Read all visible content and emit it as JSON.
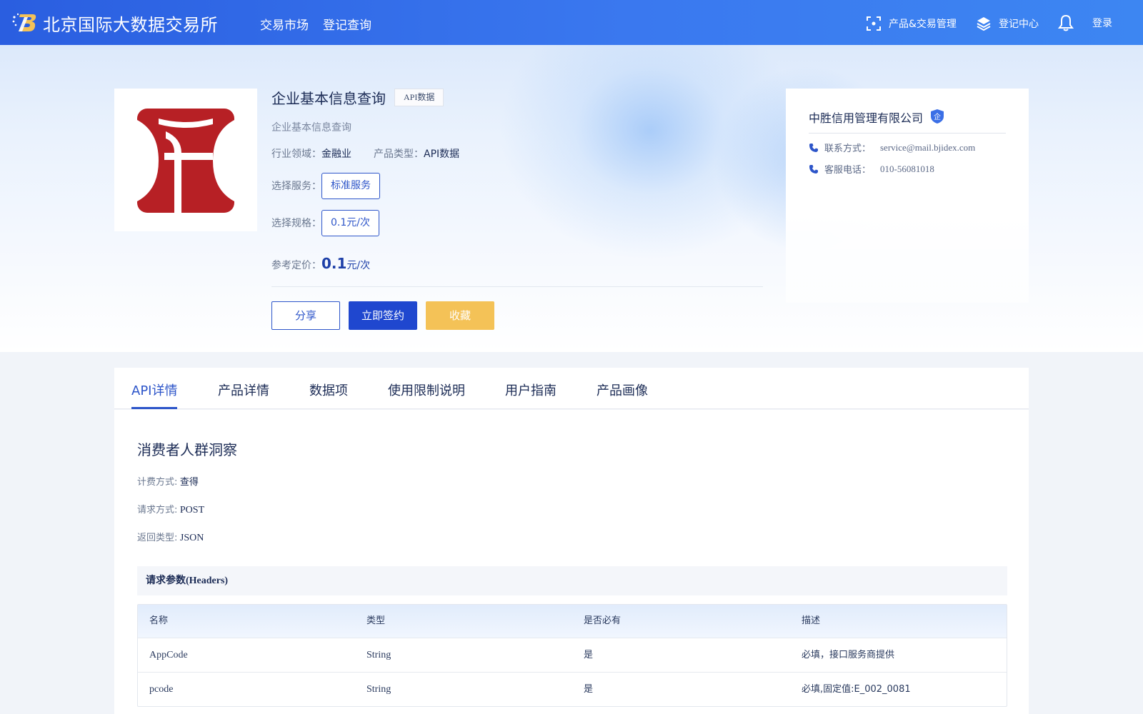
{
  "header": {
    "site_title": "北京国际大数据交易所",
    "nav": [
      "交易市场",
      "登记查询"
    ],
    "right": {
      "product_mgmt": "产品&交易管理",
      "register_center": "登记中心",
      "login": "登录"
    },
    "icons": [
      "logo-icon",
      "scan-icon",
      "layers-icon",
      "bell-icon"
    ]
  },
  "product": {
    "title": "企业基本信息查询",
    "tag": "API数据",
    "subtitle": "企业基本信息查询",
    "industry_label": "行业领域：",
    "industry_value": "金融业",
    "type_label": "产品类型：",
    "type_value": "API数据",
    "service_label": "选择服务：",
    "service_option": "标准服务",
    "spec_label": "选择规格：",
    "spec_option": "0.1元/次",
    "price_label": "参考定价：",
    "price_value": "0.1",
    "price_unit": "元/次",
    "buttons": {
      "share": "分享",
      "sign": "立即签约",
      "favorite": "收藏"
    }
  },
  "company": {
    "name": "中胜信用管理有限公司",
    "badge": "企",
    "contact_label": "联系方式：",
    "contact_value": "service@mail.bjidex.com",
    "phone_label": "客服电话：",
    "phone_value": "010-56081018"
  },
  "tabs": [
    "API详情",
    "产品详情",
    "数据项",
    "使用限制说明",
    "用户指南",
    "产品画像"
  ],
  "active_tab": "API详情",
  "api": {
    "title": "消费者人群洞察",
    "billing_label": "计费方式:",
    "billing_value": "查得",
    "method_label": "请求方式:",
    "method_value": "POST",
    "return_label": "返回类型:",
    "return_value": "JSON",
    "headers_title": "请求参数(Headers)",
    "columns": [
      "名称",
      "类型",
      "是否必有",
      "描述"
    ],
    "rows": [
      [
        "AppCode",
        "String",
        "是",
        "必填，接口服务商提供"
      ],
      [
        "pcode",
        "String",
        "是",
        "必填,固定值:E_002_0081"
      ]
    ]
  },
  "colors": {
    "primary": "#1f47cf",
    "accent_link": "#2d55c9",
    "favorite": "#f4c257",
    "logo_red": "#b72025"
  }
}
